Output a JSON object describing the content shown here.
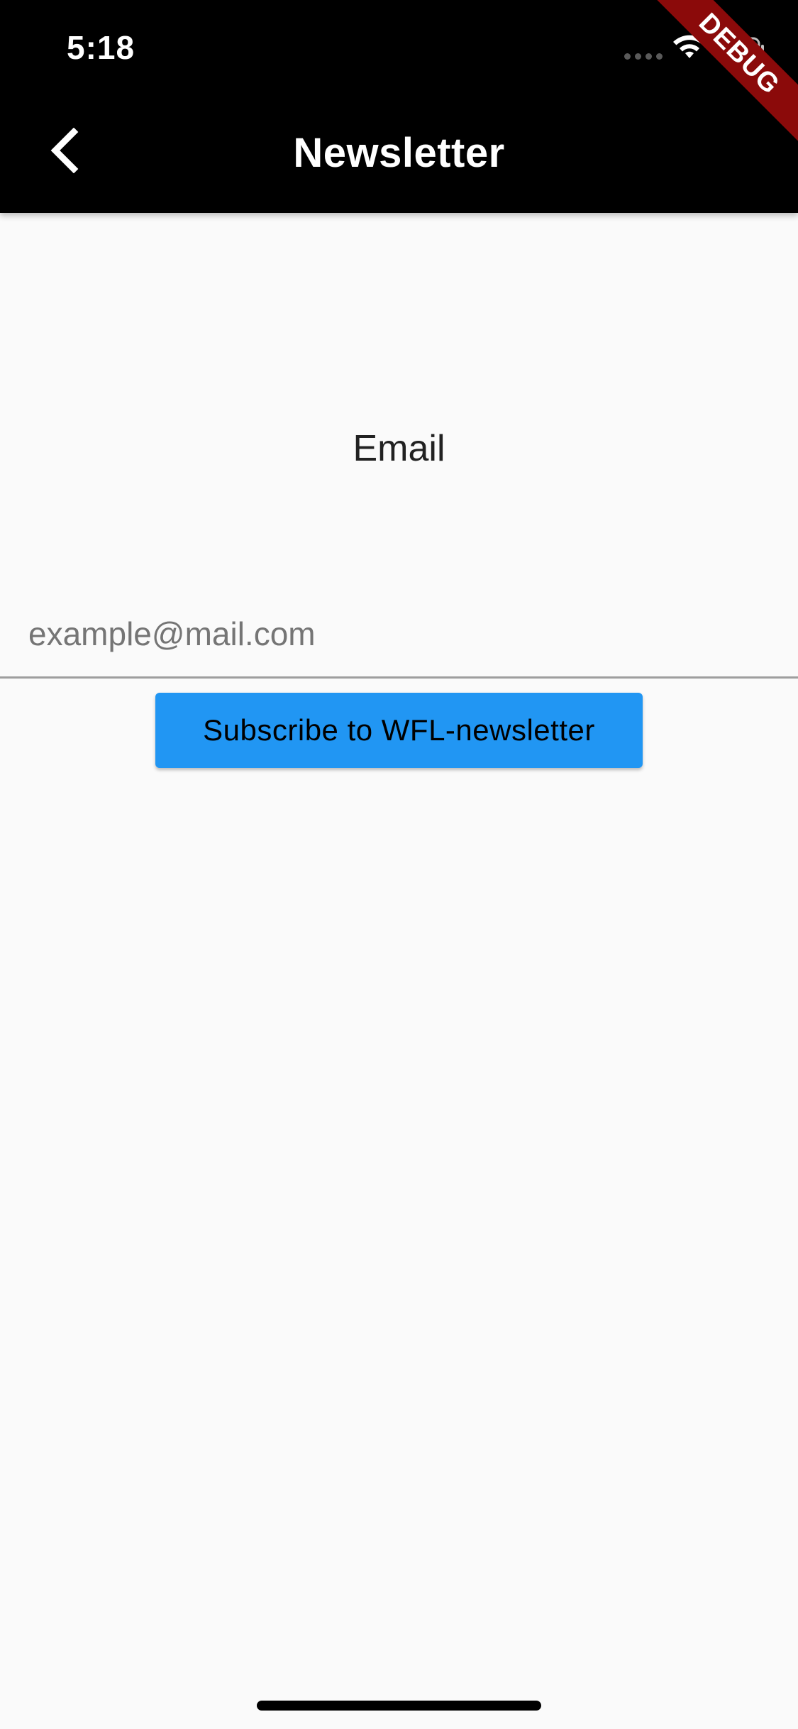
{
  "status_bar": {
    "time": "5:18",
    "wifi_icon": "wifi-icon",
    "battery_icon": "battery-icon",
    "background": "#000000"
  },
  "app_bar": {
    "title": "Newsletter",
    "back_icon": "chevron-left-icon",
    "background": "#000000"
  },
  "debug_banner": {
    "label": "DEBUG",
    "color": "#8b0a0a"
  },
  "form": {
    "email_label": "Email",
    "email_value": "",
    "email_placeholder": "example@mail.com",
    "subscribe_label": "Subscribe to WFL-newsletter",
    "button_color": "#2196f3"
  }
}
